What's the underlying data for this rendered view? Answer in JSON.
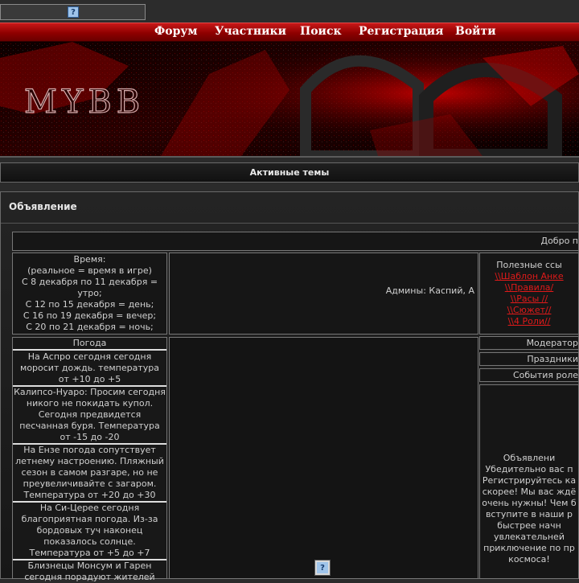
{
  "top": {
    "help_icon": "?"
  },
  "nav": [
    "Форум",
    "Участники",
    "Поиск",
    "Регистрация",
    "Войти"
  ],
  "banner": {
    "logo_text": "MYBB"
  },
  "active_topics": "Активные темы",
  "announcement": {
    "title": "Объявление",
    "welcome": "Добро п",
    "time": {
      "heading": "Время:",
      "lines": [
        "(реальное = время в игре)",
        "С 8 декабря по 11 декабря =",
        "утро;",
        "С 12 по 15 декабря = день;",
        "С 16 по 19 декабря = вечер;",
        "С 20 по 21 декабря = ночь;"
      ]
    },
    "admins": "Админы: Каспий, А",
    "links": {
      "heading": "Полезные ссы",
      "items": [
        "\\\\Шаблон Анке",
        "\\\\Правила/",
        "\\\\Расы //",
        "\\\\Сюжет//",
        "\\\\4 Роли//"
      ]
    },
    "weather": {
      "heading": "Погода",
      "items": [
        "На Аспро сегодня сегодня моросит дождь. температура от +10 до +5",
        "Калипсо-Нуаро: Просим сегодня никого не покидать купол. Сегодня предвидется песчанная буря. Температура от -15 до -20",
        "На Ензе погода сопутствует летнему настроению. Пляжный сезон в самом разгаре, но не преувеличивайте с загаром. Температура от +20 до +30",
        "На Си-Церее сегодня благоприятная погода. Из-за бордовых туч наконец показалось солнце. Температура от +5 до +7",
        "Близнецы Монсум и Гарен сегодня порадуют жителей"
      ]
    },
    "side": [
      "Модератор",
      "Праздники",
      "События роле"
    ],
    "ad_text": "Объявлени Убедительно вас п Регистрируйтесь ка скорее! Мы вас ждё очень нужны! Чем б вступите в наши р быстрее начн увлекательней приключение по пр космоса!"
  },
  "colors": {
    "accent": "#b30000",
    "link_red": "#e01a1a",
    "panel": "#161616"
  }
}
